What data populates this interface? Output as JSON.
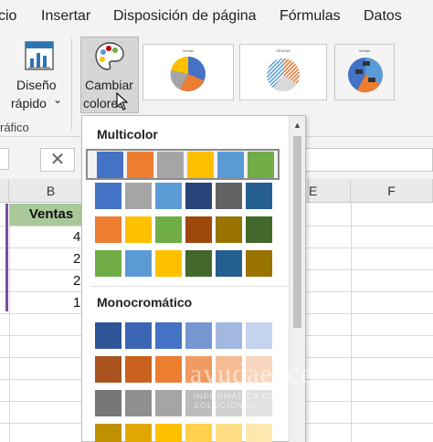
{
  "menu_tabs": [
    "cio",
    "Insertar",
    "Disposición de página",
    "Fórmulas",
    "Datos"
  ],
  "ribbon": {
    "diseno_label_1": "Diseño",
    "diseno_label_2": "rápido",
    "dropdown_caret": "⌄",
    "cambiar_label_1": "Cambiar",
    "cambiar_label_2": "colores",
    "group_label": "ráfico"
  },
  "formula_bar": {
    "cancel_glyph": "✕"
  },
  "grid": {
    "columns": [
      "B",
      "E",
      "F"
    ],
    "ventas_header": "Ventas",
    "visible_values": [
      "4",
      "2",
      "2",
      "1"
    ]
  },
  "dropdown": {
    "multicolor_heading": "Multicolor",
    "mono_heading": "Monocromático",
    "scroll_up": "▲",
    "multicolor_rows": [
      [
        "#4472c4",
        "#ed7d31",
        "#a5a5a5",
        "#ffc000",
        "#5b9bd5",
        "#70ad47"
      ],
      [
        "#4472c4",
        "#a5a5a5",
        "#5b9bd5",
        "#264478",
        "#636363",
        "#255e91"
      ],
      [
        "#ed7d31",
        "#ffc000",
        "#70ad47",
        "#9e480e",
        "#997300",
        "#43682b"
      ],
      [
        "#70ad47",
        "#5b9bd5",
        "#ffc000",
        "#43682b",
        "#255e91",
        "#997300"
      ]
    ],
    "mono_rows": [
      [
        "#2f5597",
        "#3a66b5",
        "#4472c4",
        "#7596d1",
        "#a2b8df",
        "#c5d3ec"
      ],
      [
        "#a9531e",
        "#c9621f",
        "#ed7d31",
        "#f09b62",
        "#f5bc94",
        "#f8d5bd"
      ],
      [
        "#767676",
        "#8f8f8f",
        "#a5a5a5",
        "#bcbcbc",
        "#d0d0d0",
        "#e1e1e1"
      ],
      [
        "#bf9000",
        "#e0a800",
        "#ffc000",
        "#ffd04d",
        "#ffdd85",
        "#ffe8ad"
      ]
    ]
  },
  "watermark": {
    "main": "ayudaexcel",
    "suffix": ".com",
    "sub": "INFORMATICA CON SOLUCIONES"
  }
}
